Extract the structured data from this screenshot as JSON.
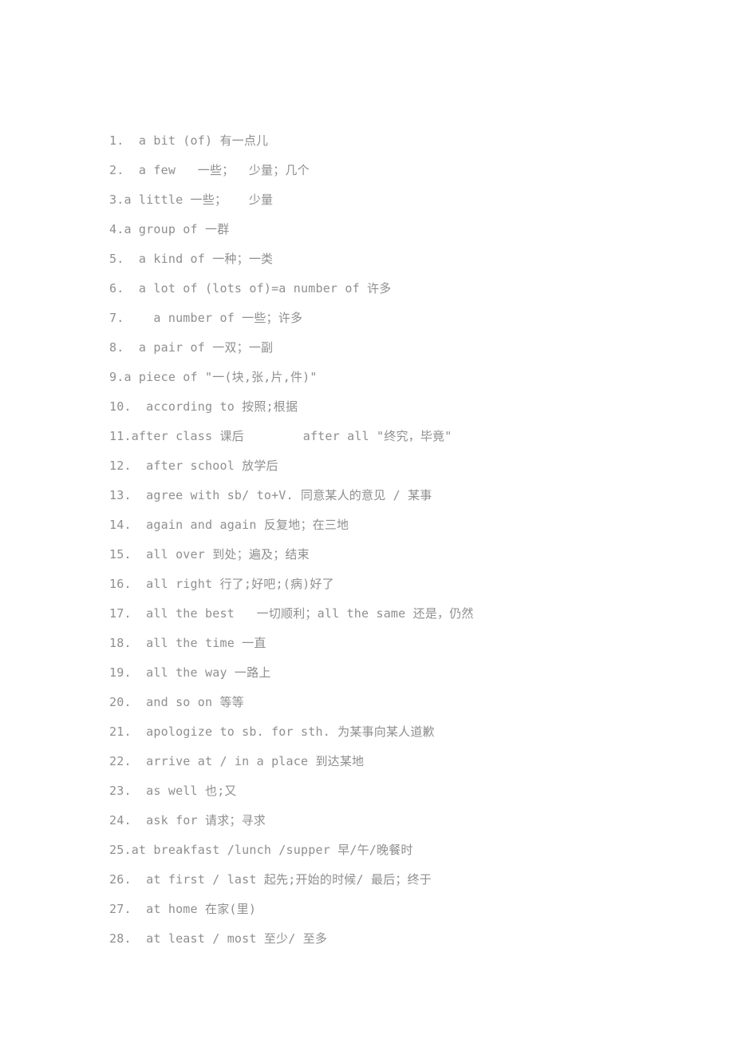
{
  "document": {
    "type": "scanned-vocabulary-list",
    "text_color": "#8f8f8f",
    "background_color": "#ffffff",
    "entries": [
      {
        "number": "1.",
        "text": "1.  a bit (of) 有一点儿"
      },
      {
        "number": "2.",
        "text": "2.  a few   一些；  少量；几个"
      },
      {
        "number": "3.",
        "text": "3.a little 一些；   少量"
      },
      {
        "number": "4.",
        "text": "4.a group of 一群"
      },
      {
        "number": "5.",
        "text": "5.  a kind of 一种；一类"
      },
      {
        "number": "6.",
        "text": "6.  a lot of (lots of)=a number of 许多"
      },
      {
        "number": "7.",
        "text": "7.    a number of 一些；许多"
      },
      {
        "number": "8.",
        "text": "8.  a pair of 一双；一副"
      },
      {
        "number": "9.",
        "text": "9.a piece of \"一(块,张,片,件)\""
      },
      {
        "number": "10.",
        "text": "10.  according to 按照;根据"
      },
      {
        "number": "11.",
        "text": "11.after class 课后        after all \"终究，毕竟\""
      },
      {
        "number": "12.",
        "text": "12.  after school 放学后"
      },
      {
        "number": "13.",
        "text": "13.  agree with sb/ to+V. 同意某人的意见 / 某事"
      },
      {
        "number": "14.",
        "text": "14.  again and again 反复地；在三地"
      },
      {
        "number": "15.",
        "text": "15.  all over 到处；遍及；结束"
      },
      {
        "number": "16.",
        "text": "16.  all right 行了;好吧;(病)好了"
      },
      {
        "number": "17.",
        "text": "17.  all the best   一切顺利；all the same 还是，仍然"
      },
      {
        "number": "18.",
        "text": "18.  all the time 一直"
      },
      {
        "number": "19.",
        "text": "19.  all the way 一路上"
      },
      {
        "number": "20.",
        "text": "20.  and so on 等等"
      },
      {
        "number": "21.",
        "text": "21.  apologize to sb. for sth. 为某事向某人道歉"
      },
      {
        "number": "22.",
        "text": "22.  arrive at / in a place 到达某地"
      },
      {
        "number": "23.",
        "text": "23.  as well 也;又"
      },
      {
        "number": "24.",
        "text": "24.  ask for 请求；寻求"
      },
      {
        "number": "25.",
        "text": "25.at breakfast /lunch /supper 早/午/晚餐时"
      },
      {
        "number": "26.",
        "text": "26.  at first / last 起先;开始的时候/ 最后；终于"
      },
      {
        "number": "27.",
        "text": "27.  at home 在家(里)"
      },
      {
        "number": "28.",
        "text": "28.  at least / most 至少/ 至多"
      }
    ]
  }
}
